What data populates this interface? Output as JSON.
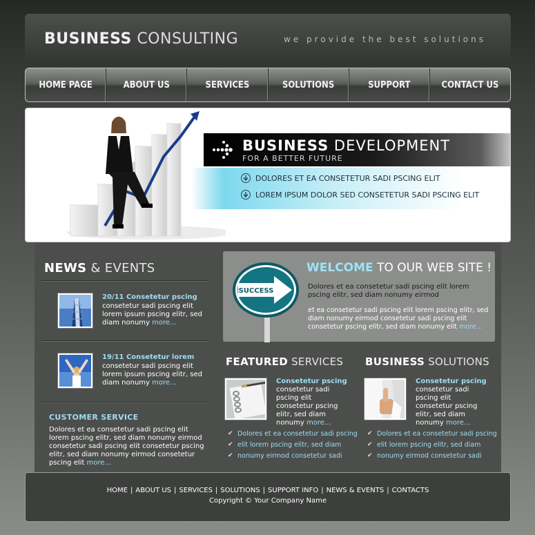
{
  "header": {
    "logo_bold": "BUSINESS",
    "logo_thin": "CONSULTING",
    "tagline": "we provide the best solutions"
  },
  "nav": [
    "HOME PAGE",
    "ABOUT US",
    "SERVICES",
    "SOLUTIONS",
    "SUPPORT",
    "CONTACT US"
  ],
  "banner": {
    "title_bold": "BUSINESS",
    "title_thin": "DEVELOPMENT",
    "subtitle": "FOR A BETTER FUTURE",
    "line1": "DOLORES ET EA CONSETETUR SADI PSCING ELIT",
    "line2": "LOREM IPSUM DOLOR SED CONSETETUR SADI PSCING ELIT"
  },
  "news": {
    "heading_bold": "NEWS",
    "heading_thin": "& EVENTS",
    "items": [
      {
        "date": "20/11 Consetetur pscing",
        "text": "consetetur sadi pscing elit lorem ipsum  pscing elitr, sed diam nonumy",
        "more": "more..."
      },
      {
        "date": "19/11 Consetetur lorem",
        "text": "consetetur sadi pscing elit lorem ipsum  pscing elitr, sed diam nonumy",
        "more": "more..."
      }
    ]
  },
  "customer": {
    "title": "CUSTOMER SERVICE",
    "text": "Dolores et ea consetetur sadi pscing elit lorem pscing elitr, sed diam nonumy eirmod consetetur sadi pscing elit consetetur pscing elitr, sed diam nonumy eirmod  consetetur pscing elit",
    "more": "more..."
  },
  "welcome": {
    "sign": "SUCCESS",
    "heading_bold": "WELCOME",
    "heading_thin": "TO OUR WEB SITE !",
    "p1": "Dolores et ea consetetur sadi pscing elit lorem pscing elitr, sed diam nonumy eirmod",
    "p2": "et ea consetetur sadi pscing elit lorem pscing elitr, sed diam nonumy eirmod consetetur sadi pscing elit consetetur pscing elitr, sed diam nonumy elit",
    "more": "more..."
  },
  "featured": {
    "heading_bold": "FEATURED",
    "heading_thin": "SERVICES",
    "title": "Consetetur pscing",
    "text": "consetetur sadi pscing elit consetetur pscing elitr, sed diam nonumy",
    "more": "more...",
    "list": [
      "Dolores et ea consetetur sadi pscing",
      "elit lorem pscing elitr, sed diam",
      "nonumy eirmod consetetur sadi"
    ]
  },
  "business": {
    "heading_bold": "BUSINESS",
    "heading_thin": "SOLUTIONS",
    "title": "Consetetur pscing",
    "text": "consetetur sadi pscing elit consetetur pscing elitr, sed diam nonumy",
    "more": "more...",
    "list": [
      "Dolores et ea consetetur sadi pscing",
      "elit lorem pscing elitr, sed diam",
      "nonumy eirmod consetetur sadi"
    ]
  },
  "footer": {
    "links": [
      "HOME",
      "ABOUT US",
      "SERVICES",
      "SOLUTIONS",
      "SUPPORT INFO",
      "NEWS & EVENTS",
      "CONTACTS"
    ],
    "separator": "|",
    "copyright": "Copyright © Your Company Name"
  },
  "colors": {
    "accent": "#9fdcf2",
    "panel": "#4c4e4c",
    "banner_cyan": "#7dd8ee"
  }
}
